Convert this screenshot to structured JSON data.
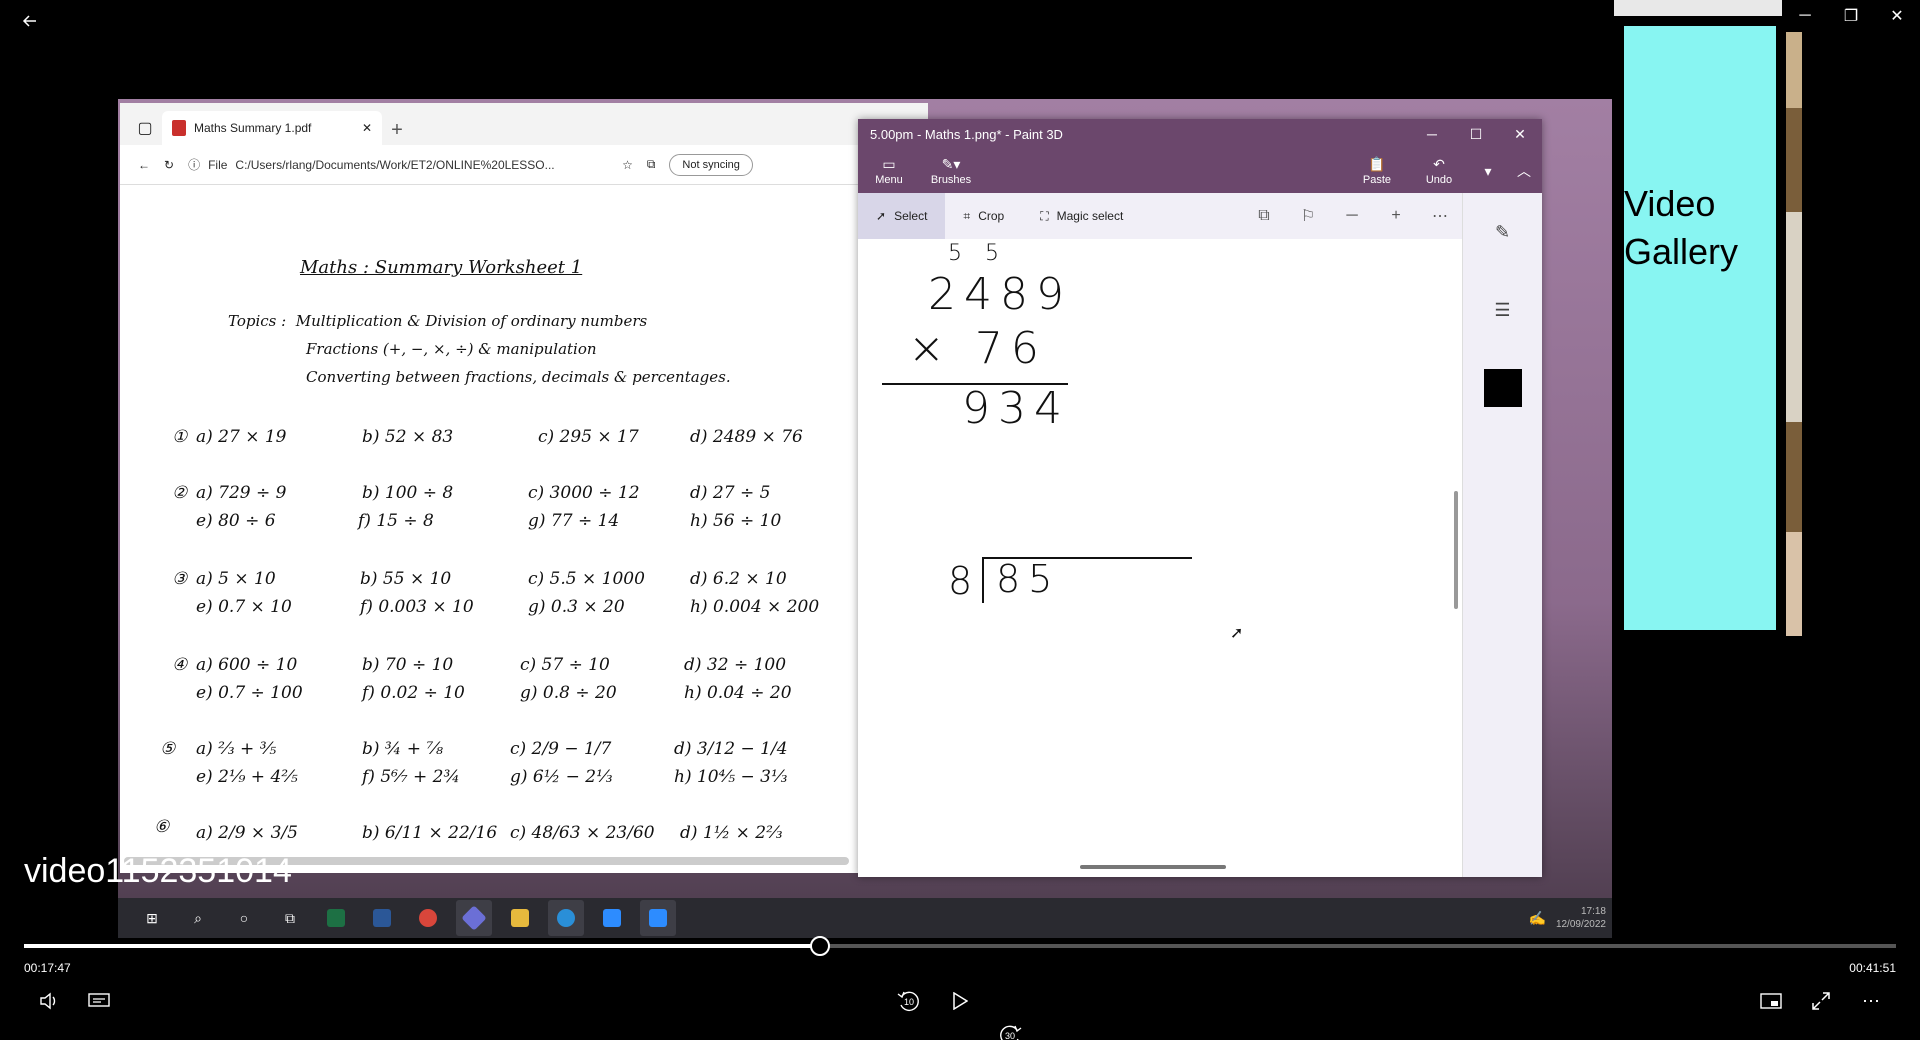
{
  "player": {
    "video_name": "video1152351014",
    "time_current": "00:17:47",
    "time_total": "00:41:51",
    "progress_fraction": 0.425,
    "skip_back": "10",
    "skip_forward": "30"
  },
  "gallery": {
    "label_line1": "Video",
    "label_line2": "Gallery",
    "bg_color": "#88f5f2"
  },
  "edge": {
    "tab_title": "Maths Summary 1.pdf",
    "file_label": "File",
    "url": "C:/Users/rlang/Documents/Work/ET2/ONLINE%20LESSO...",
    "sync_label": "Not syncing"
  },
  "pdf": {
    "title": "Maths : Summary Worksheet 1",
    "topics_label": "Topics :",
    "topics": [
      "Multiplication & Division of ordinary numbers",
      "Fractions (+, −, ×, ÷) & manipulation",
      "Converting between fractions, decimals & percentages."
    ],
    "questions": [
      {
        "num": "①",
        "items": [
          "a) 27 × 19",
          "b) 52 × 83",
          "c) 295 × 17",
          "d) 2489 × 76"
        ]
      },
      {
        "num": "②",
        "items": [
          "a) 729 ÷ 9",
          "b) 100 ÷ 8",
          "c) 3000 ÷ 12",
          "d) 27 ÷ 5",
          "e) 80 ÷ 6",
          "f) 15 ÷ 8",
          "g) 77 ÷ 14",
          "h) 56 ÷ 10"
        ]
      },
      {
        "num": "③",
        "items": [
          "a) 5 × 10",
          "b) 55 × 10",
          "c) 5.5 × 1000",
          "d) 6.2 × 10",
          "e) 0.7 × 10",
          "f) 0.003 × 10",
          "g) 0.3 × 20",
          "h) 0.004 × 200"
        ]
      },
      {
        "num": "④",
        "items": [
          "a) 600 ÷ 10",
          "b) 70 ÷ 10",
          "c) 57 ÷ 10",
          "d) 32 ÷ 100",
          "e) 0.7 ÷ 100",
          "f) 0.02 ÷ 10",
          "g) 0.8 ÷ 20",
          "h) 0.04 ÷ 20"
        ]
      },
      {
        "num": "⑤",
        "items": [
          "a) ⅔ + ⅗",
          "b) ¾ + ⅞",
          "c) 2/9 − 1/7",
          "d) 3/12 − 1/4",
          "e) 2⅑ + 4⅖",
          "f) 5⁶⁄₇ + 2¾",
          "g) 6½ − 2⅓",
          "h) 10⅘ − 3⅓"
        ]
      },
      {
        "num": "⑥",
        "items": [
          "a) 2/9 × 3/5",
          "b) 6/11 × 22/16",
          "c) 48/63 × 23/60",
          "d) 1½ × 2⅔"
        ]
      }
    ]
  },
  "paint": {
    "title": "5.00pm - Maths 1.png* - Paint 3D",
    "ribbon": {
      "menu": "Menu",
      "brushes": "Brushes",
      "paste": "Paste",
      "undo": "Undo"
    },
    "tools": {
      "select": "Select",
      "crop": "Crop",
      "magic_select": "Magic select"
    },
    "canvas": {
      "carry": "5 5",
      "top_number": "2489",
      "multiplier": "× 76",
      "partial": "934",
      "divisor": "8",
      "dividend": "85"
    },
    "active_color": "#000000"
  },
  "taskbar": {
    "time": "17:18",
    "date": "12/09/2022"
  }
}
